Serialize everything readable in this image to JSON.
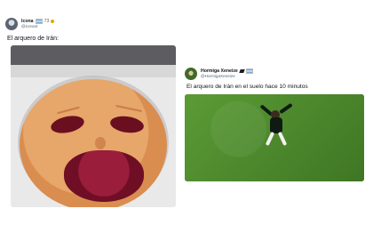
{
  "tweets": [
    {
      "name": "Icona",
      "count": "73",
      "handle": "@iconaX",
      "text": "El arquero de Irán:"
    },
    {
      "name": "Hormiga Xeneize",
      "handle": "@HormigaXeneize",
      "text": "El arquero de Irán en el suelo hace 10 minutos"
    }
  ],
  "colors": {
    "verified": "#e0a800",
    "handle": "#536471",
    "grass": "#4f8a2e"
  }
}
